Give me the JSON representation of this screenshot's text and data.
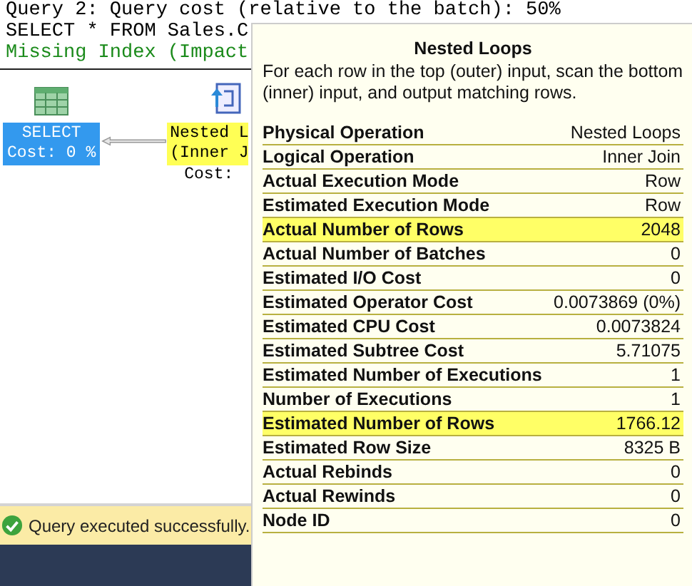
{
  "query_lines": [
    {
      "text": "Query 2: Query cost (relative to the batch): 50%",
      "kind": "plain"
    },
    {
      "text": "SELECT * FROM Sales.C",
      "kind": "plain"
    },
    {
      "text": "Missing Index (Impact",
      "kind": "hint"
    }
  ],
  "plan_nodes": [
    {
      "lines": [
        "SELECT",
        "Cost: 0 %"
      ],
      "selected": true
    },
    {
      "lines": [
        "Nested L",
        "(Inner J"
      ],
      "cost": "Cost:",
      "selected": false
    }
  ],
  "tooltip": {
    "title": "Nested Loops",
    "description": "For each row in the top (outer) input, scan the bottom (inner) input, and output matching rows.",
    "rows": [
      {
        "label": "Physical Operation",
        "value": "Nested Loops",
        "highlighted": false
      },
      {
        "label": "Logical Operation",
        "value": "Inner Join",
        "highlighted": false
      },
      {
        "label": "Actual Execution Mode",
        "value": "Row",
        "highlighted": false
      },
      {
        "label": "Estimated Execution Mode",
        "value": "Row",
        "highlighted": false
      },
      {
        "label": "Actual Number of Rows",
        "value": "2048",
        "highlighted": true
      },
      {
        "label": "Actual Number of Batches",
        "value": "0",
        "highlighted": false
      },
      {
        "label": "Estimated I/O Cost",
        "value": "0",
        "highlighted": false
      },
      {
        "label": "Estimated Operator Cost",
        "value": "0.0073869 (0%)",
        "highlighted": false
      },
      {
        "label": "Estimated CPU Cost",
        "value": "0.0073824",
        "highlighted": false
      },
      {
        "label": "Estimated Subtree Cost",
        "value": "5.71075",
        "highlighted": false
      },
      {
        "label": "Estimated Number of Executions",
        "value": "1",
        "highlighted": false
      },
      {
        "label": "Number of Executions",
        "value": "1",
        "highlighted": false
      },
      {
        "label": "Estimated Number of Rows",
        "value": "1766.12",
        "highlighted": true
      },
      {
        "label": "Estimated Row Size",
        "value": "8325 B",
        "highlighted": false
      },
      {
        "label": "Actual Rebinds",
        "value": "0",
        "highlighted": false
      },
      {
        "label": "Actual Rewinds",
        "value": "0",
        "highlighted": false
      },
      {
        "label": "Node ID",
        "value": "0",
        "highlighted": false
      }
    ]
  },
  "status_bar": {
    "message": "Query executed successfully."
  }
}
